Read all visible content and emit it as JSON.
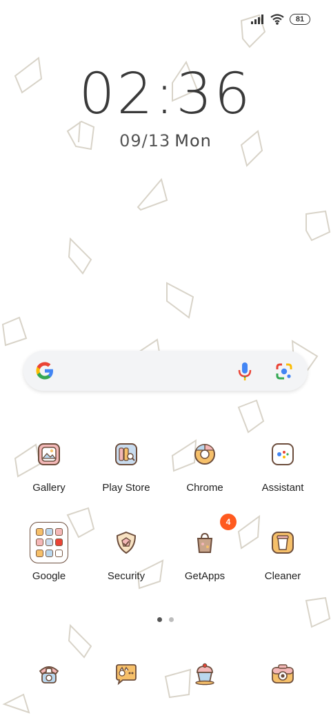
{
  "status_bar": {
    "battery": "81"
  },
  "clock": {
    "time": "02:36",
    "date": "09/13",
    "weekday": "Mon"
  },
  "search": {
    "icons": [
      "google-g-icon",
      "microphone-icon",
      "google-lens-icon"
    ]
  },
  "apps_row1": [
    {
      "label": "Gallery",
      "icon": "gallery-icon"
    },
    {
      "label": "Play Store",
      "icon": "play-store-icon"
    },
    {
      "label": "Chrome",
      "icon": "chrome-icon"
    },
    {
      "label": "Assistant",
      "icon": "assistant-icon"
    }
  ],
  "apps_row2": [
    {
      "label": "Google",
      "icon": "folder-icon"
    },
    {
      "label": "Security",
      "icon": "security-icon"
    },
    {
      "label": "GetApps",
      "icon": "getapps-icon",
      "badge": "4"
    },
    {
      "label": "Cleaner",
      "icon": "cleaner-icon"
    }
  ],
  "dock": [
    {
      "icon": "phone-icon"
    },
    {
      "icon": "messages-icon"
    },
    {
      "icon": "browser-cupcake-icon"
    },
    {
      "icon": "camera-icon"
    }
  ],
  "page_indicator": {
    "pages": 2,
    "active": 1
  },
  "colors": {
    "badge": "#ff5a1f",
    "icon_outline": "#6b4c3b"
  }
}
